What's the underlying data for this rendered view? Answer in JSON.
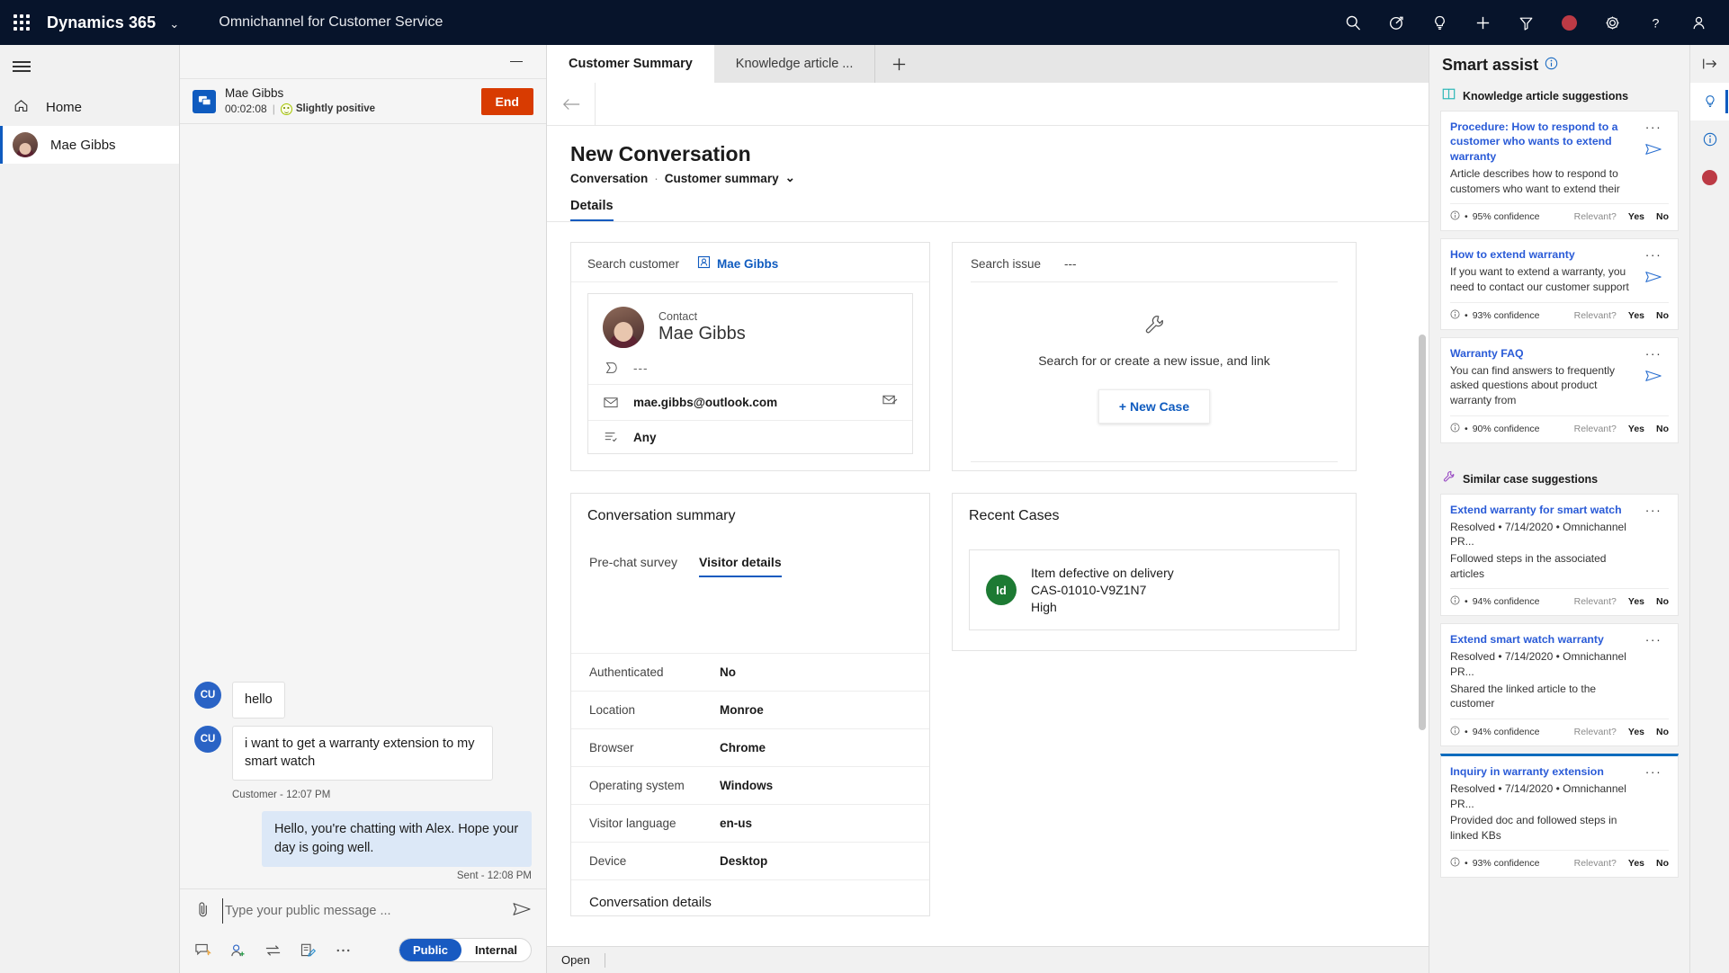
{
  "topnav": {
    "waffle": "app-launcher",
    "brand": "Dynamics 365",
    "caret": "⌄",
    "app_name": "Omnichannel for Customer Service",
    "icons": [
      "search-icon",
      "timer-icon",
      "lightbulb-icon",
      "plus-icon",
      "filter-icon",
      "presence-dot-icon",
      "gear-icon",
      "help-icon",
      "account-icon"
    ]
  },
  "sidebar": {
    "hamburger": "site-map-toggle",
    "items": [
      {
        "label": "Home",
        "icon": "home-icon"
      },
      {
        "label": "Mae Gibbs",
        "icon": "avatar"
      }
    ]
  },
  "conversation": {
    "minimize": "—",
    "customer_name": "Mae Gibbs",
    "timer": "00:02:08",
    "separator": "|",
    "sentiment": "Slightly positive",
    "end_label": "End",
    "messages": [
      {
        "sender": "CU",
        "text": "hello",
        "direction": "in"
      },
      {
        "sender": "CU",
        "text": "i want to get a warranty extension to my smart watch",
        "direction": "in"
      }
    ],
    "in_stamp": "Customer - 12:07 PM",
    "agent_message": "Hello, you're chatting with Alex. Hope your day is going well.",
    "out_stamp": "Sent - 12:08 PM",
    "composer": {
      "placeholder": "Type your public message ...",
      "value": "",
      "attach": "attachment-icon",
      "send": "send-icon",
      "tools": [
        "quick-reply-icon",
        "agent-consult-icon",
        "transfer-icon",
        "note-icon",
        "more-icon"
      ],
      "toggle_public": "Public",
      "toggle_internal": "Internal"
    }
  },
  "main": {
    "tabs": [
      {
        "label": "Customer Summary",
        "active": true
      },
      {
        "label": "Knowledge article ...",
        "active": false
      }
    ],
    "tab_add": "+",
    "back": "back-arrow",
    "page_title": "New Conversation",
    "breadcrumb_entity": "Conversation",
    "breadcrumb_dot": "·",
    "breadcrumb_form": "Customer summary",
    "breadcrumb_caret": "⌄",
    "section_tab": "Details",
    "customer_card": {
      "search_label": "Search customer",
      "chip": "Mae Gibbs",
      "role": "Contact",
      "name": "Mae Gibbs",
      "rows": [
        {
          "icon": "tag-icon",
          "value": "---",
          "dim": true
        },
        {
          "icon": "mail-icon",
          "value": "mae.gibbs@outlook.com",
          "action": "send-mail-icon"
        },
        {
          "icon": "preference-icon",
          "value": "Any"
        }
      ]
    },
    "issue_card": {
      "label": "Search issue",
      "value": "---",
      "empty_icon": "wrench-icon",
      "empty_text": "Search for or create a new issue, and link",
      "new_case": "+ New Case"
    },
    "conversation_summary": {
      "title": "Conversation summary",
      "tabs": [
        {
          "label": "Pre-chat survey",
          "active": false
        },
        {
          "label": "Visitor details",
          "active": true
        }
      ],
      "rows": [
        {
          "key": "Authenticated",
          "value": "No"
        },
        {
          "key": "Location",
          "value": "Monroe"
        },
        {
          "key": "Browser",
          "value": "Chrome"
        },
        {
          "key": "Operating system",
          "value": "Windows"
        },
        {
          "key": "Visitor language",
          "value": "en-us"
        },
        {
          "key": "Device",
          "value": "Desktop"
        }
      ],
      "next_section": "Conversation details"
    },
    "recent_cases": {
      "title": "Recent Cases",
      "items": [
        {
          "badge": "Id",
          "title": "Item defective on delivery",
          "number": "CAS-01010-V9Z1N7",
          "priority": "High"
        }
      ]
    },
    "status": {
      "open": "Open"
    }
  },
  "smart_assist": {
    "title": "Smart assist",
    "info_icon": "info-icon",
    "groups": [
      {
        "icon": "knowledge-icon",
        "label": "Knowledge article suggestions",
        "cards": [
          {
            "title": "Procedure: How to respond to a customer who wants to extend warranty",
            "desc": "Article describes how to respond to customers who want to extend their",
            "sub": "",
            "confidence": "95% confidence",
            "relevant": "Relevant?",
            "yes": "Yes",
            "no": "No",
            "selected": false
          },
          {
            "title": "How to extend warranty",
            "desc": "If you want to extend a warranty, you need to contact our customer support",
            "sub": "",
            "confidence": "93% confidence",
            "relevant": "Relevant?",
            "yes": "Yes",
            "no": "No",
            "selected": false
          },
          {
            "title": "Warranty FAQ",
            "desc": "You can find answers to frequently asked questions about product warranty from",
            "sub": "",
            "confidence": "90% confidence",
            "relevant": "Relevant?",
            "yes": "Yes",
            "no": "No",
            "selected": false
          }
        ]
      },
      {
        "icon": "wrench-icon",
        "label": "Similar case suggestions",
        "cards": [
          {
            "title": "Extend warranty for smart watch",
            "desc": "Resolved • 7/14/2020 • Omnichannel PR...",
            "sub": "Followed steps in the associated articles",
            "confidence": "94% confidence",
            "relevant": "Relevant?",
            "yes": "Yes",
            "no": "No",
            "selected": false
          },
          {
            "title": "Extend smart watch warranty",
            "desc": "Resolved • 7/14/2020 • Omnichannel PR...",
            "sub": "Shared the linked article to the customer",
            "confidence": "94% confidence",
            "relevant": "Relevant?",
            "yes": "Yes",
            "no": "No",
            "selected": false
          },
          {
            "title": "Inquiry in warranty extension",
            "desc": "Resolved • 7/14/2020 • Omnichannel PR...",
            "sub": "Provided doc and followed steps in linked KBs",
            "confidence": "93% confidence",
            "relevant": "Relevant?",
            "yes": "Yes",
            "no": "No",
            "selected": true
          }
        ]
      }
    ],
    "bullet": "•"
  },
  "rail": {
    "buttons": [
      "expand-panel-icon",
      "lightbulb-icon",
      "info-icon",
      "presence-dot-icon"
    ]
  },
  "colors": {
    "nav_bg": "#07142b",
    "accent": "#0f5bbf",
    "link": "#2a5bd7",
    "end_button": "#d83b01",
    "presence": "#bc3a45",
    "case_badge": "#1d7a33",
    "agent_bubble": "#dce8f7"
  }
}
